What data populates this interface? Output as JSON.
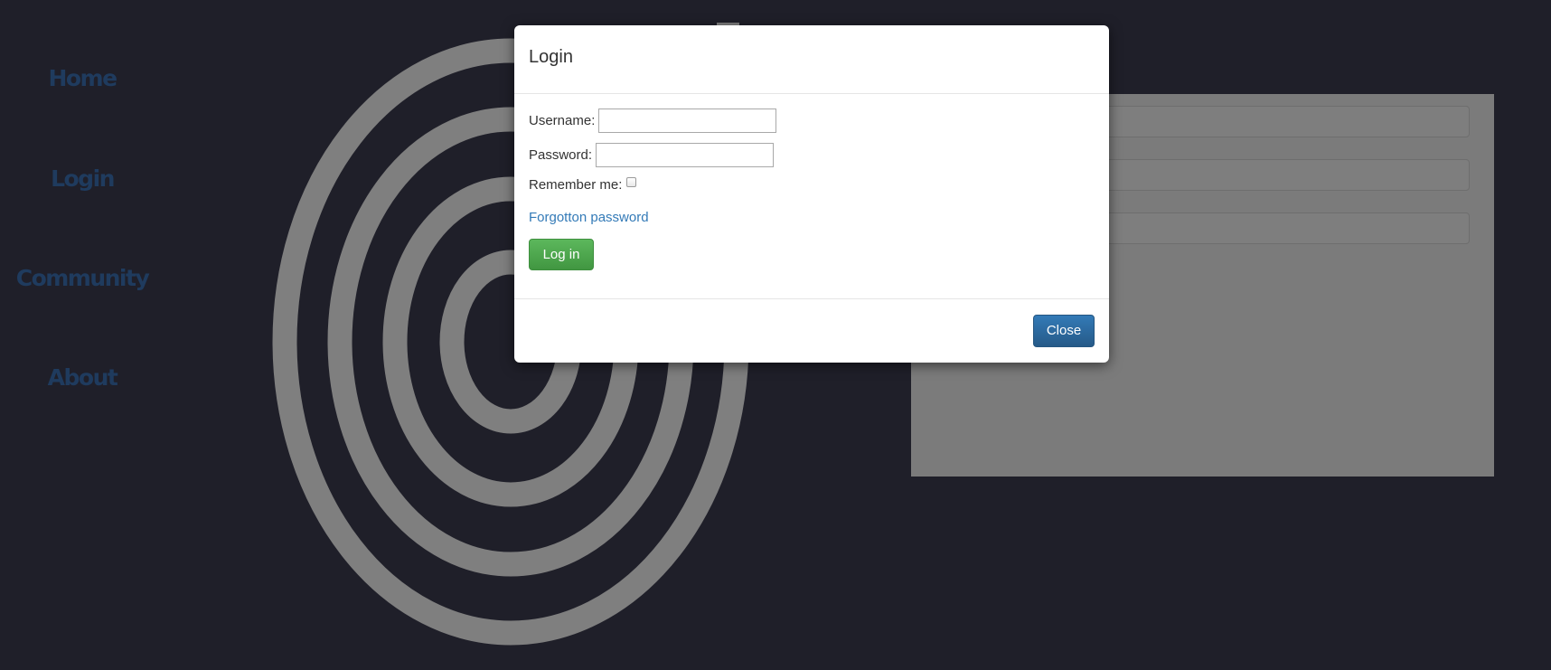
{
  "nav": {
    "items": [
      {
        "label": "Home"
      },
      {
        "label": "Login"
      },
      {
        "label": "Community"
      },
      {
        "label": "About"
      }
    ]
  },
  "modal": {
    "title": "Login",
    "username_label": "Username:",
    "username_value": "",
    "password_label": "Password:",
    "password_value": "",
    "remember_label": "Remember me:",
    "remember_checked": false,
    "forgot_link": "Forgotton password",
    "login_button": "Log in",
    "close_button": "Close"
  },
  "colors": {
    "background": "#1f1f29",
    "nav_text": "#1f3b5e",
    "rings": "#7f7f7f",
    "login_button": "#5cb85c",
    "close_button": "#337ab7",
    "link": "#337ab7"
  },
  "icons": {
    "background_logo": "concentric-rings-logo",
    "remember_checkbox": "checkbox"
  }
}
